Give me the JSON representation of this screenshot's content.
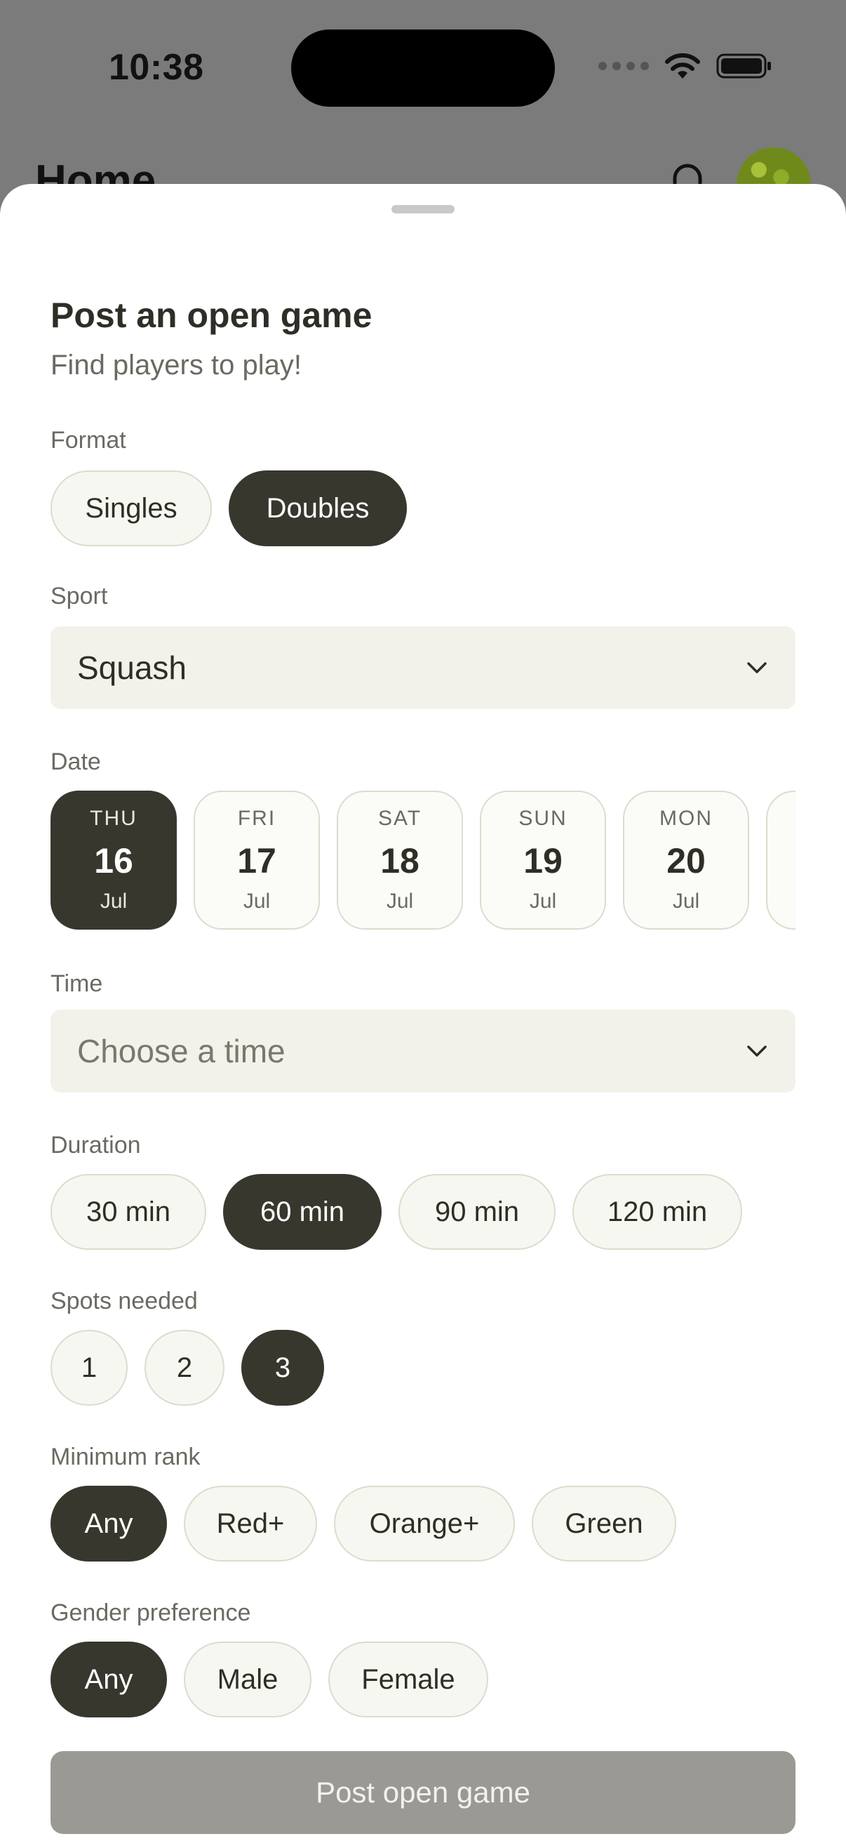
{
  "status_bar": {
    "time": "10:38"
  },
  "background_screen": {
    "title": "Home"
  },
  "sheet": {
    "title": "Post an open game",
    "subtitle": "Find players to play!",
    "format": {
      "label": "Format",
      "options": [
        "Singles",
        "Doubles"
      ],
      "selected": "Doubles"
    },
    "sport": {
      "label": "Sport",
      "value": "Squash"
    },
    "date": {
      "label": "Date",
      "days": [
        {
          "dow": "THU",
          "day": "16",
          "month": "Jul",
          "selected": true
        },
        {
          "dow": "FRI",
          "day": "17",
          "month": "Jul",
          "selected": false
        },
        {
          "dow": "SAT",
          "day": "18",
          "month": "Jul",
          "selected": false
        },
        {
          "dow": "SUN",
          "day": "19",
          "month": "Jul",
          "selected": false
        },
        {
          "dow": "MON",
          "day": "20",
          "month": "Jul",
          "selected": false
        }
      ]
    },
    "time": {
      "label": "Time",
      "placeholder": "Choose a time"
    },
    "duration": {
      "label": "Duration",
      "options": [
        "30 min",
        "60 min",
        "90 min",
        "120 min"
      ],
      "selected": "60 min"
    },
    "spots": {
      "label": "Spots needed",
      "options": [
        "1",
        "2",
        "3"
      ],
      "selected": "3"
    },
    "min_rank": {
      "label": "Minimum rank",
      "options": [
        "Any",
        "Red+",
        "Orange+",
        "Green"
      ],
      "selected": "Any"
    },
    "gender": {
      "label": "Gender preference",
      "options": [
        "Any",
        "Male",
        "Female"
      ],
      "selected": "Any"
    },
    "submit_label": "Post open game"
  },
  "colors": {
    "selected": "#38372e",
    "chip_bg": "#f7f7f1",
    "chip_border": "#dedbcd",
    "button_disabled": "#9a9994"
  }
}
